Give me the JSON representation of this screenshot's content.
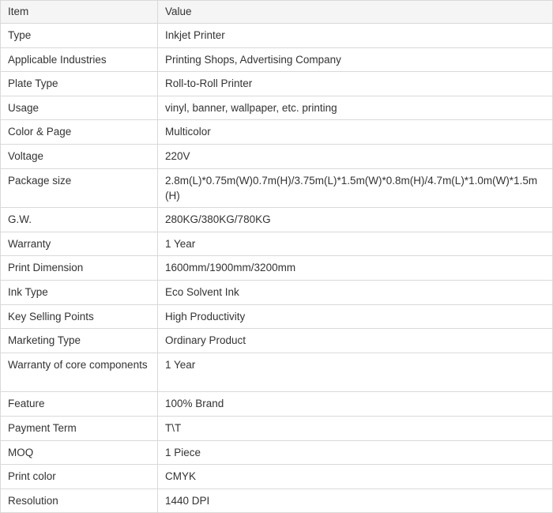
{
  "table": {
    "header": {
      "item": "Item",
      "value": "Value"
    },
    "rows": [
      {
        "item": "Type",
        "value": "Inkjet Printer"
      },
      {
        "item": "Applicable Industries",
        "value": "Printing Shops, Advertising Company"
      },
      {
        "item": "Plate Type",
        "value": "Roll-to-Roll Printer"
      },
      {
        "item": "Usage",
        "value": "vinyl, banner, wallpaper, etc. printing"
      },
      {
        "item": "Color & Page",
        "value": "Multicolor"
      },
      {
        "item": "Voltage",
        "value": "220V"
      },
      {
        "item": "Package size",
        "value": "2.8m(L)*0.75m(W)0.7m(H)/3.75m(L)*1.5m(W)*0.8m(H)/4.7m(L)*1.0m(W)*1.5m(H)"
      },
      {
        "item": "G.W.",
        "value": "280KG/380KG/780KG"
      },
      {
        "item": "Warranty",
        "value": "1 Year"
      },
      {
        "item": "Print Dimension",
        "value": "1600mm/1900mm/3200mm"
      },
      {
        "item": "Ink Type",
        "value": "Eco Solvent Ink"
      },
      {
        "item": "Key Selling Points",
        "value": "High Productivity"
      },
      {
        "item": "Marketing Type",
        "value": "Ordinary Product"
      },
      {
        "item": "Warranty of core components",
        "value": "1 Year"
      },
      {
        "item": "Feature",
        "value": "100% Brand"
      },
      {
        "item": "Payment Term",
        "value": "T\\T"
      },
      {
        "item": "MOQ",
        "value": "1 Piece"
      },
      {
        "item": "Print color",
        "value": "CMYK"
      },
      {
        "item": "Resolution",
        "value": "1440 DPI"
      }
    ]
  }
}
